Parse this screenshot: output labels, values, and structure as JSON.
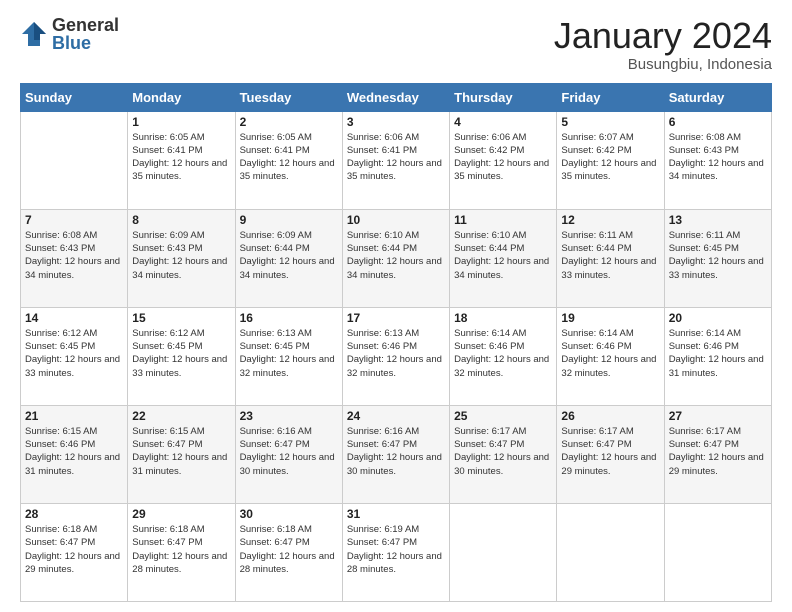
{
  "logo": {
    "general": "General",
    "blue": "Blue"
  },
  "title": {
    "month": "January 2024",
    "location": "Busungbiu, Indonesia"
  },
  "weekdays": [
    "Sunday",
    "Monday",
    "Tuesday",
    "Wednesday",
    "Thursday",
    "Friday",
    "Saturday"
  ],
  "weeks": [
    [
      {
        "day": "",
        "sunrise": "",
        "sunset": "",
        "daylight": ""
      },
      {
        "day": "1",
        "sunrise": "Sunrise: 6:05 AM",
        "sunset": "Sunset: 6:41 PM",
        "daylight": "Daylight: 12 hours and 35 minutes."
      },
      {
        "day": "2",
        "sunrise": "Sunrise: 6:05 AM",
        "sunset": "Sunset: 6:41 PM",
        "daylight": "Daylight: 12 hours and 35 minutes."
      },
      {
        "day": "3",
        "sunrise": "Sunrise: 6:06 AM",
        "sunset": "Sunset: 6:41 PM",
        "daylight": "Daylight: 12 hours and 35 minutes."
      },
      {
        "day": "4",
        "sunrise": "Sunrise: 6:06 AM",
        "sunset": "Sunset: 6:42 PM",
        "daylight": "Daylight: 12 hours and 35 minutes."
      },
      {
        "day": "5",
        "sunrise": "Sunrise: 6:07 AM",
        "sunset": "Sunset: 6:42 PM",
        "daylight": "Daylight: 12 hours and 35 minutes."
      },
      {
        "day": "6",
        "sunrise": "Sunrise: 6:08 AM",
        "sunset": "Sunset: 6:43 PM",
        "daylight": "Daylight: 12 hours and 34 minutes."
      }
    ],
    [
      {
        "day": "7",
        "sunrise": "Sunrise: 6:08 AM",
        "sunset": "Sunset: 6:43 PM",
        "daylight": "Daylight: 12 hours and 34 minutes."
      },
      {
        "day": "8",
        "sunrise": "Sunrise: 6:09 AM",
        "sunset": "Sunset: 6:43 PM",
        "daylight": "Daylight: 12 hours and 34 minutes."
      },
      {
        "day": "9",
        "sunrise": "Sunrise: 6:09 AM",
        "sunset": "Sunset: 6:44 PM",
        "daylight": "Daylight: 12 hours and 34 minutes."
      },
      {
        "day": "10",
        "sunrise": "Sunrise: 6:10 AM",
        "sunset": "Sunset: 6:44 PM",
        "daylight": "Daylight: 12 hours and 34 minutes."
      },
      {
        "day": "11",
        "sunrise": "Sunrise: 6:10 AM",
        "sunset": "Sunset: 6:44 PM",
        "daylight": "Daylight: 12 hours and 34 minutes."
      },
      {
        "day": "12",
        "sunrise": "Sunrise: 6:11 AM",
        "sunset": "Sunset: 6:44 PM",
        "daylight": "Daylight: 12 hours and 33 minutes."
      },
      {
        "day": "13",
        "sunrise": "Sunrise: 6:11 AM",
        "sunset": "Sunset: 6:45 PM",
        "daylight": "Daylight: 12 hours and 33 minutes."
      }
    ],
    [
      {
        "day": "14",
        "sunrise": "Sunrise: 6:12 AM",
        "sunset": "Sunset: 6:45 PM",
        "daylight": "Daylight: 12 hours and 33 minutes."
      },
      {
        "day": "15",
        "sunrise": "Sunrise: 6:12 AM",
        "sunset": "Sunset: 6:45 PM",
        "daylight": "Daylight: 12 hours and 33 minutes."
      },
      {
        "day": "16",
        "sunrise": "Sunrise: 6:13 AM",
        "sunset": "Sunset: 6:45 PM",
        "daylight": "Daylight: 12 hours and 32 minutes."
      },
      {
        "day": "17",
        "sunrise": "Sunrise: 6:13 AM",
        "sunset": "Sunset: 6:46 PM",
        "daylight": "Daylight: 12 hours and 32 minutes."
      },
      {
        "day": "18",
        "sunrise": "Sunrise: 6:14 AM",
        "sunset": "Sunset: 6:46 PM",
        "daylight": "Daylight: 12 hours and 32 minutes."
      },
      {
        "day": "19",
        "sunrise": "Sunrise: 6:14 AM",
        "sunset": "Sunset: 6:46 PM",
        "daylight": "Daylight: 12 hours and 32 minutes."
      },
      {
        "day": "20",
        "sunrise": "Sunrise: 6:14 AM",
        "sunset": "Sunset: 6:46 PM",
        "daylight": "Daylight: 12 hours and 31 minutes."
      }
    ],
    [
      {
        "day": "21",
        "sunrise": "Sunrise: 6:15 AM",
        "sunset": "Sunset: 6:46 PM",
        "daylight": "Daylight: 12 hours and 31 minutes."
      },
      {
        "day": "22",
        "sunrise": "Sunrise: 6:15 AM",
        "sunset": "Sunset: 6:47 PM",
        "daylight": "Daylight: 12 hours and 31 minutes."
      },
      {
        "day": "23",
        "sunrise": "Sunrise: 6:16 AM",
        "sunset": "Sunset: 6:47 PM",
        "daylight": "Daylight: 12 hours and 30 minutes."
      },
      {
        "day": "24",
        "sunrise": "Sunrise: 6:16 AM",
        "sunset": "Sunset: 6:47 PM",
        "daylight": "Daylight: 12 hours and 30 minutes."
      },
      {
        "day": "25",
        "sunrise": "Sunrise: 6:17 AM",
        "sunset": "Sunset: 6:47 PM",
        "daylight": "Daylight: 12 hours and 30 minutes."
      },
      {
        "day": "26",
        "sunrise": "Sunrise: 6:17 AM",
        "sunset": "Sunset: 6:47 PM",
        "daylight": "Daylight: 12 hours and 29 minutes."
      },
      {
        "day": "27",
        "sunrise": "Sunrise: 6:17 AM",
        "sunset": "Sunset: 6:47 PM",
        "daylight": "Daylight: 12 hours and 29 minutes."
      }
    ],
    [
      {
        "day": "28",
        "sunrise": "Sunrise: 6:18 AM",
        "sunset": "Sunset: 6:47 PM",
        "daylight": "Daylight: 12 hours and 29 minutes."
      },
      {
        "day": "29",
        "sunrise": "Sunrise: 6:18 AM",
        "sunset": "Sunset: 6:47 PM",
        "daylight": "Daylight: 12 hours and 28 minutes."
      },
      {
        "day": "30",
        "sunrise": "Sunrise: 6:18 AM",
        "sunset": "Sunset: 6:47 PM",
        "daylight": "Daylight: 12 hours and 28 minutes."
      },
      {
        "day": "31",
        "sunrise": "Sunrise: 6:19 AM",
        "sunset": "Sunset: 6:47 PM",
        "daylight": "Daylight: 12 hours and 28 minutes."
      },
      {
        "day": "",
        "sunrise": "",
        "sunset": "",
        "daylight": ""
      },
      {
        "day": "",
        "sunrise": "",
        "sunset": "",
        "daylight": ""
      },
      {
        "day": "",
        "sunrise": "",
        "sunset": "",
        "daylight": ""
      }
    ]
  ]
}
